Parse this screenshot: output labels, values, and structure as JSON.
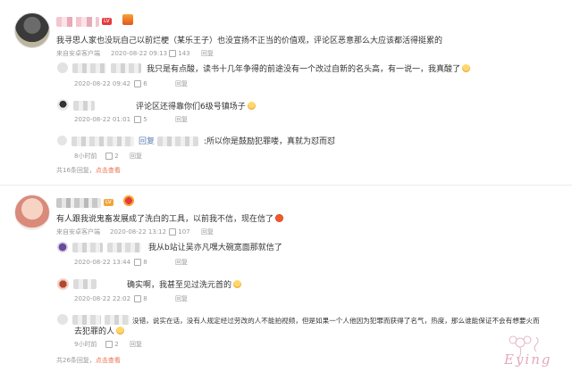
{
  "thread1": {
    "comment_text": "我寻思人家也没玩自己以前烂梗（某乐王子）也没宣扬不正当的价值观，评论区恶意那么大应该都活得挺累的",
    "source": "来自安卓客户端",
    "time": "2020-08-22 09:13",
    "likes": "143",
    "reply_label": "回复",
    "replies": [
      {
        "text": "我只是有点酸，读书十几年争得的前途没有一个改过自新的名头高，有一说一，我真酸了",
        "time": "2020-08-22 09:42",
        "likes": "6",
        "reply_label": "回复"
      },
      {
        "text": "评论区还得靠你们6级号镇场子",
        "time": "2020-08-22 01:01",
        "likes": "5",
        "reply_label": "回复"
      },
      {
        "prefix": "回复",
        "text": ":所以你是鼓励犯罪喽，真就为怼而怼",
        "time": "8小时前",
        "likes": "2",
        "reply_label": "回复"
      }
    ],
    "summary_count": "共16条回复，",
    "summary_link": "点击查看"
  },
  "thread2": {
    "comment_text": "有人跟我说鬼畜发展成了洗白的工具，以前我不信，现在信了",
    "source": "来自安卓客户端",
    "time": "2020-08-22 13:12",
    "likes": "107",
    "reply_label": "回复",
    "replies": [
      {
        "text": "我从b站让吴亦凡嘿大碗宽面那就信了",
        "time": "2020-08-22 13:44",
        "likes": "8",
        "reply_label": "回复"
      },
      {
        "text": "确实啊，我甚至见过洗元首的",
        "time": "2020-08-22 22:02",
        "likes": "8",
        "reply_label": "回复"
      },
      {
        "text_line1": "没错，说实在话，没有人规定经过劳改的人不能拍视频，但是如果一个人他因为犯罪而获得了名气，热度，那么谁能保证不会有想要火而",
        "text_line2": "去犯罪的人",
        "time": "9小时前",
        "likes": "2",
        "reply_label": "回复"
      }
    ],
    "summary_count": "共26条回复，",
    "summary_link": "点击查看"
  },
  "watermark": "Eying",
  "colors": {
    "link": "#eb7350",
    "name_blue": "#5d7fb4",
    "meta": "#999999"
  }
}
